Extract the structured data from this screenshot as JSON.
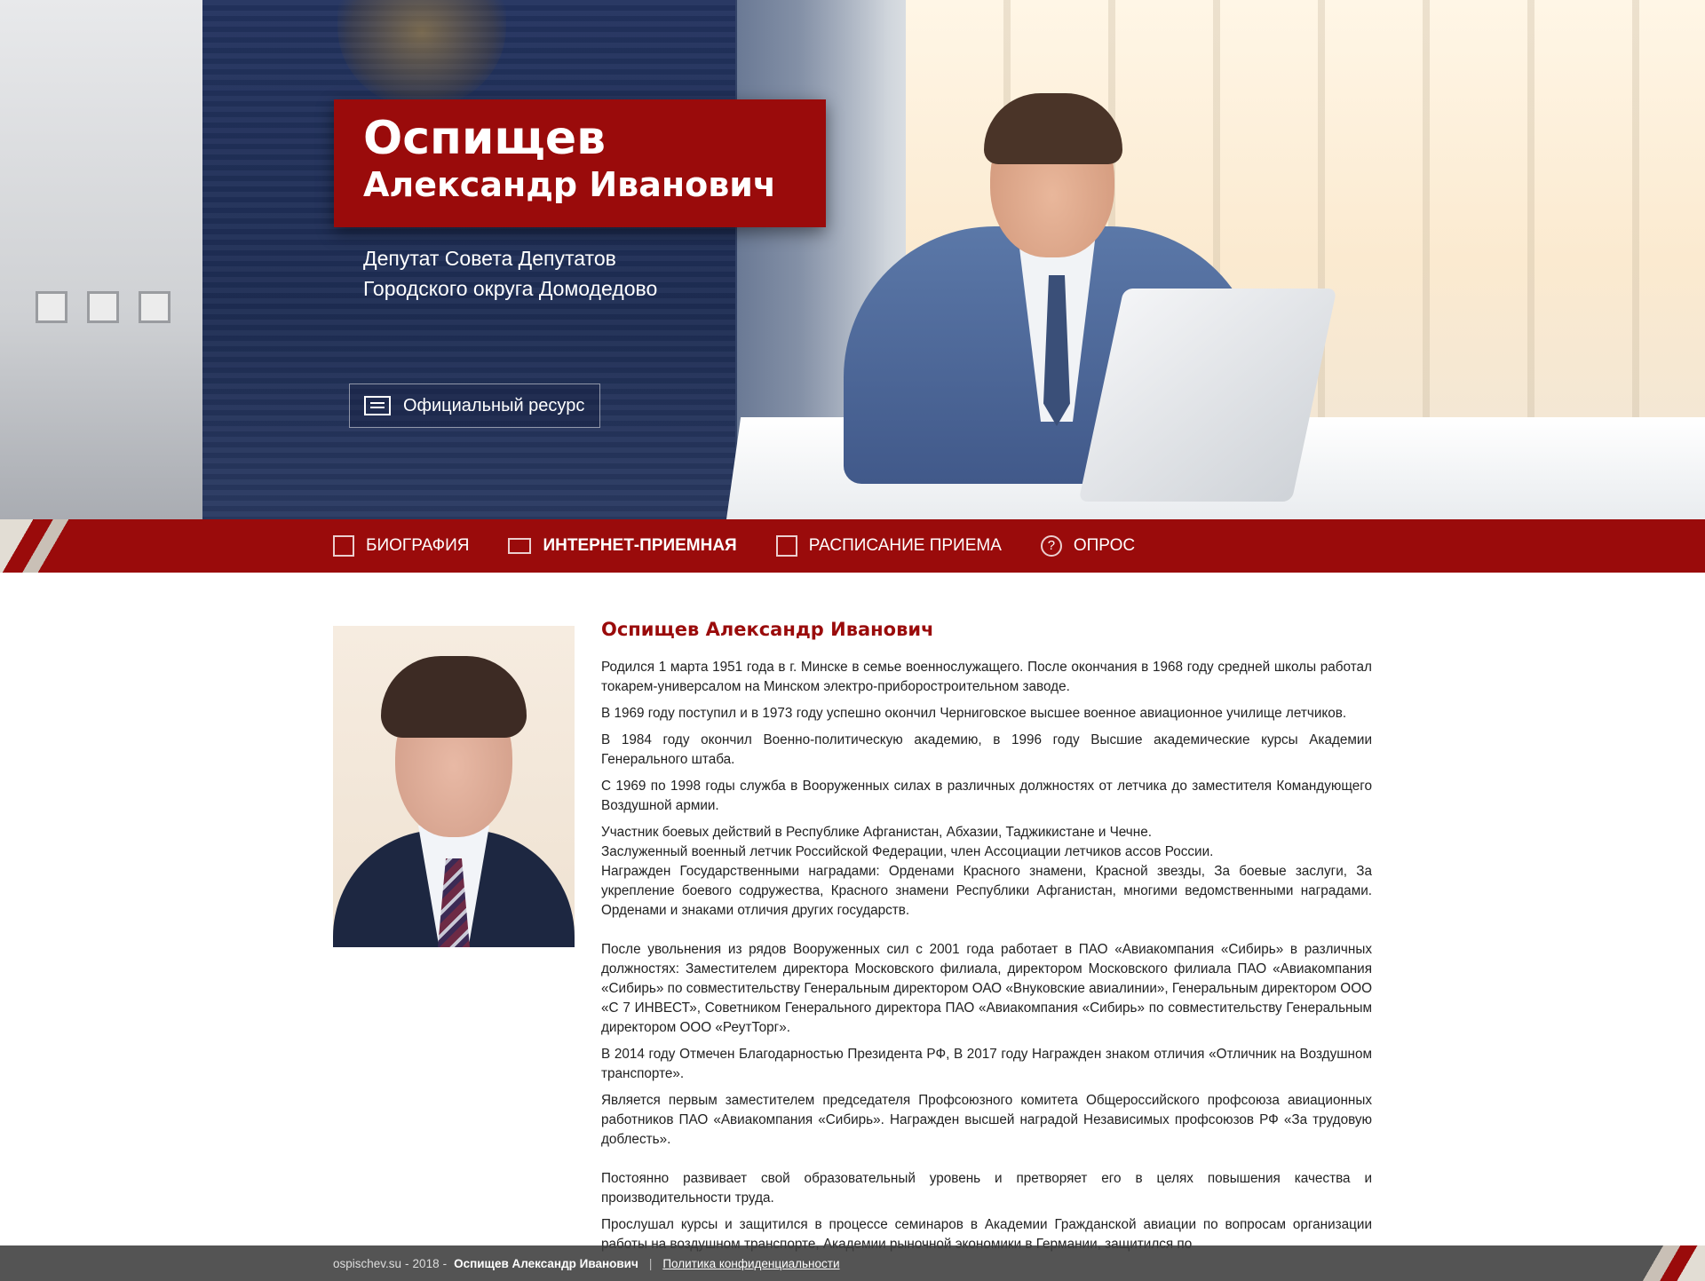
{
  "hero": {
    "name_line1": "Оспищев",
    "name_line2": "Александр Иванович",
    "subtitle_line1": "Депутат Совета Депутатов",
    "subtitle_line2": "Городского округа Домодедово",
    "official_button": "Официальный ресурс"
  },
  "nav": {
    "items": [
      {
        "label": "БИОГРАФИЯ",
        "icon": "edit-icon"
      },
      {
        "label": "ИНТЕРНЕТ-ПРИЕМНАЯ",
        "icon": "mail-icon"
      },
      {
        "label": "РАСПИСАНИЕ ПРИЕМА",
        "icon": "calendar-icon"
      },
      {
        "label": "ОПРОС",
        "icon": "question-icon"
      }
    ],
    "active_index": 1
  },
  "article": {
    "title": "Оспищев Александр Иванович",
    "paragraphs": [
      "Родился 1 марта 1951 года в г. Минске в семье военнослужащего. После окончания в 1968 году средней школы работал токарем-универсалом на Минском электро-приборостроительном  заводе.",
      "В 1969 году поступил и в 1973 году успешно окончил Черниговское высшее военное авиационное училище летчиков.",
      "В 1984 году окончил Военно-политическую академию, в 1996 году Высшие академические курсы Академии Генерального штаба.",
      "С 1969 по 1998 годы служба в Вооруженных силах в различных должностях от  летчика до заместителя Командующего Воздушной армии.",
      "Участник боевых действий в Республике Афганистан, Абхазии, Таджикистане и Чечне.",
      "Заслуженный военный летчик Российской Федерации, член Ассоциации летчиков ассов России.",
      "Награжден  Государственными наградами: Орденами  Красного знамени, Красной звезды, За боевые заслуги, За укрепление боевого содружества,  Красного знамени Республики Афганистан, многими ведомственными наградами. Орденами и знаками отличия других государств.",
      "После увольнения из рядов Вооруженных сил с 2001 года работает в ПАО «Авиакомпания «Сибирь» в различных должностях: Заместителем директора Московского филиала, директором Московского филиала ПАО «Авиакомпания «Сибирь»  по совместительству Генеральным директором ОАО «Внуковские  авиалинии», Генеральным директором ООО «С 7 ИНВЕСТ», Советником Генерального директора ПАО «Авиакомпания «Сибирь» по совместительству Генеральным директором ООО «РеутТорг».",
      "В 2014 году Отмечен Благодарностью Президента РФ, В 2017 году Награжден знаком отличия «Отличник на Воздушном транспорте».",
      "Является  первым заместителем председателя Профсоюзного комитета Общероссийского профсоюза авиационных работников   ПАО «Авиакомпания «Сибирь». Награжден высшей наградой Независимых профсоюзов РФ «За трудовую доблесть».",
      "Постоянно  развивает свой образовательный уровень и претворяет его в целях повышения качества и производительности труда.",
      "Прослушал курсы и защитился в процессе семинаров в Академии Гражданской авиации по вопросам организации работы на воздушном транспорте, Академии рыночной экономики в Германии, защитился по"
    ]
  },
  "footer": {
    "site": "ospischev.su",
    "year": "2018",
    "name": "Оспищев Александр Иванович",
    "separator": "|",
    "privacy_link": "Политика конфиденциальности"
  },
  "colors": {
    "brand_red": "#9a0b0b",
    "navy": "#23335f",
    "footer_bg": "#3c3c3c"
  }
}
